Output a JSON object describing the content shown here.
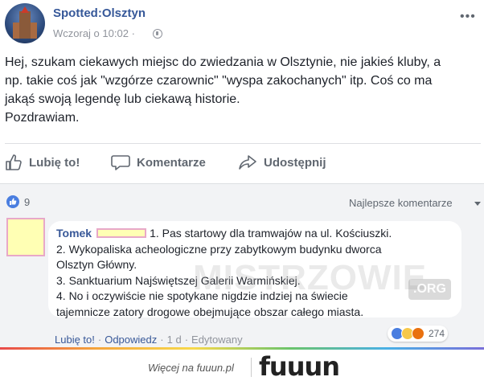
{
  "post": {
    "page_name": "Spotted:Olsztyn",
    "timestamp": "Wczoraj o 10:02",
    "timestamp_sep": "·",
    "text_lines": [
      "Hej, szukam ciekawych miejsc do zwiedzania w Olsztynie, nie jakieś kluby, a",
      "np. takie coś jak \"wzgórze czarownic\" \"wyspa zakochanych\" itp. Coś co ma",
      "jakąś swoją legendę lub ciekawą historie.",
      "Pozdrawiam."
    ]
  },
  "actions": {
    "like": "Lubię to!",
    "comment": "Komentarze",
    "share": "Udostępnij"
  },
  "reactions": {
    "count": "9",
    "sort_label": "Najlepsze komentarze"
  },
  "comment": {
    "author": "Tomek",
    "first_line": "1. Pas startowy dla tramwajów na ul. Kościuszki.",
    "lines": [
      "2. Wykopaliska acheologiczne przy zabytkowym budynku dworca",
      "Olsztyn Główny.",
      "3. Sanktuarium Najświętszej Galerii Warmińskiej.",
      "4. No i oczywiście nie spotykane nigdzie indziej na świecie",
      "tajemnicze zatory drogowe obejmujące obszar całego miasta."
    ],
    "reaction_count": "274",
    "like_link": "Lubię to!",
    "reply_link": "Odpowiedz",
    "age": "1 d",
    "edited": "Edytowany"
  },
  "watermark": {
    "text": "MISTRZOWIE",
    "suffix": ".ORG"
  },
  "footer": {
    "text": "Więcej na fuuun.pl",
    "logo": "fuuun"
  },
  "colors": {
    "link": "#365899",
    "like_blue": "#4a7ee0",
    "comment_bg": "#f2f3f5"
  },
  "icons": {
    "globe": "globe-icon",
    "more": "more-icon",
    "like": "thumbs-up-icon",
    "comment": "speech-bubble-icon",
    "share": "share-arrow-icon"
  }
}
